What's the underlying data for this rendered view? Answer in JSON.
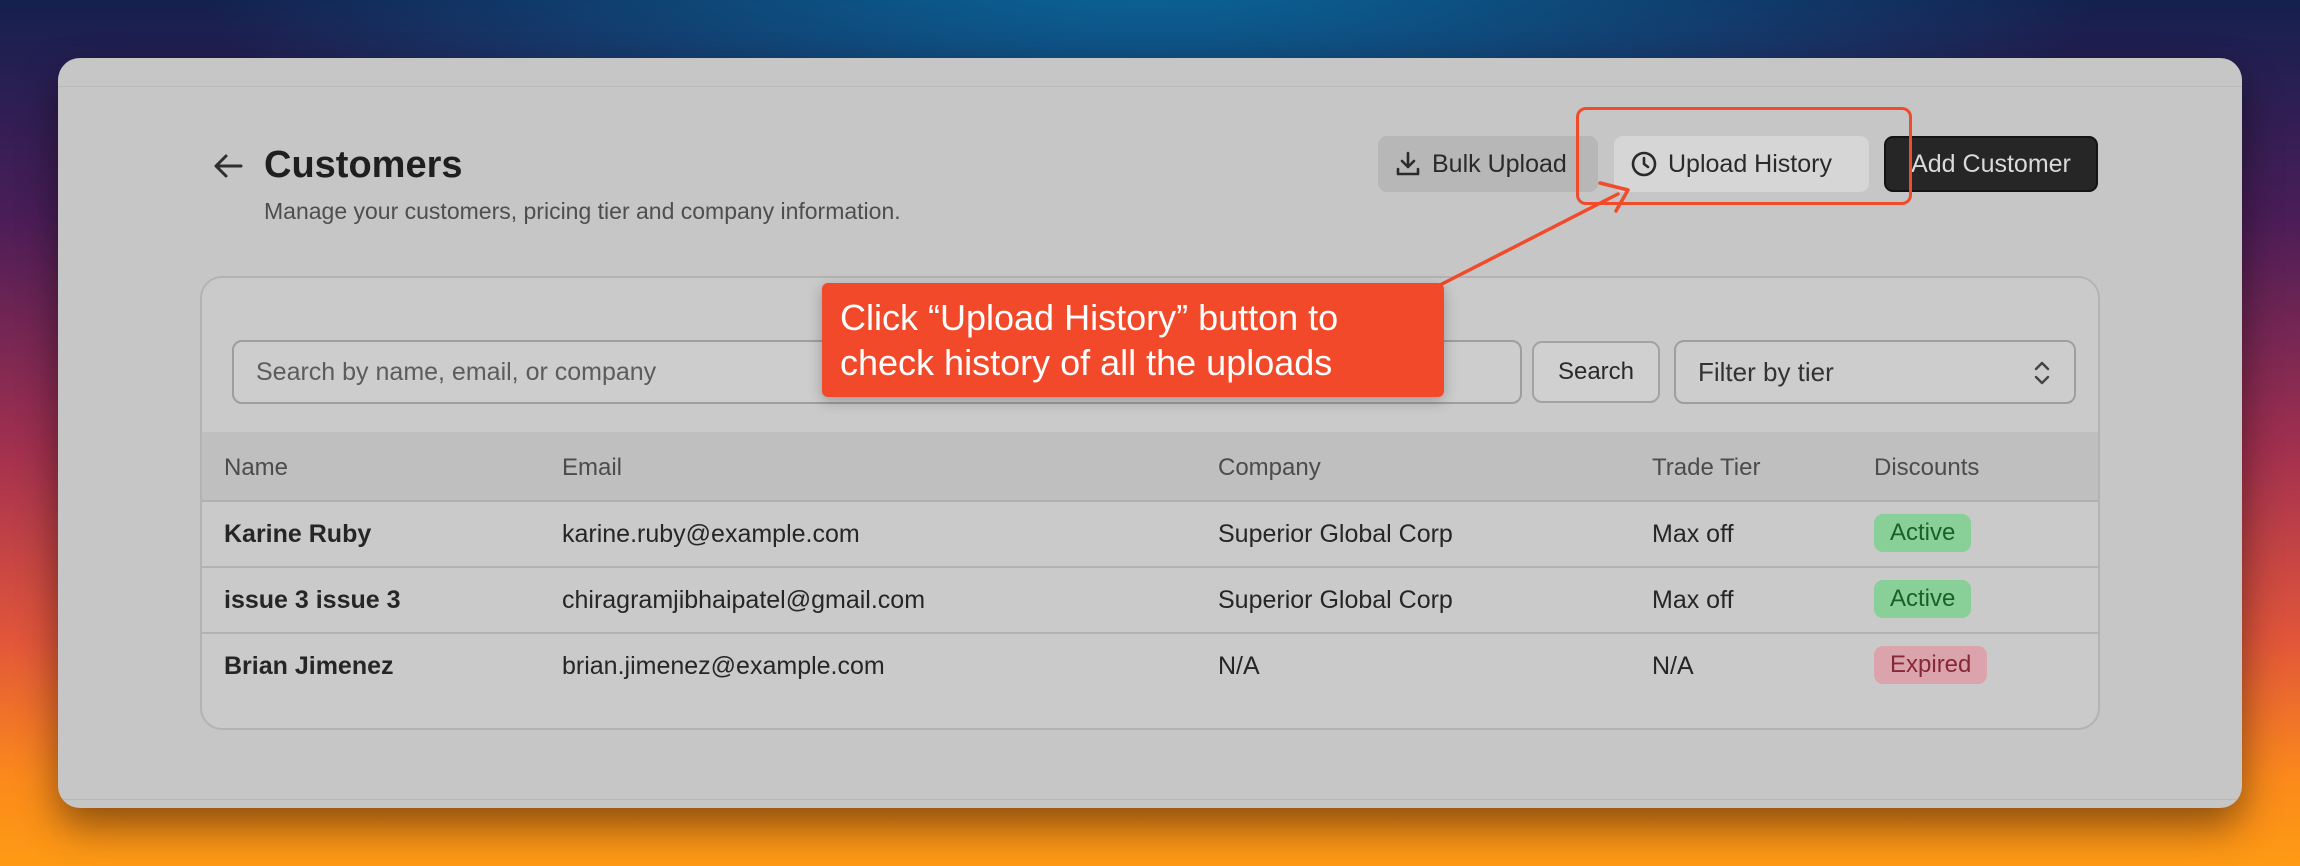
{
  "header": {
    "title": "Customers",
    "subtitle": "Manage your customers, pricing tier and company information.",
    "bulk_upload_label": "Bulk Upload",
    "upload_history_label": "Upload History",
    "add_customer_label": "Add Customer"
  },
  "filters": {
    "search_placeholder": "Search by name, email, or company",
    "search_button_label": "Search",
    "tier_select_value": "Filter by tier"
  },
  "table": {
    "columns": [
      "Name",
      "Email",
      "Company",
      "Trade Tier",
      "Discounts"
    ],
    "rows": [
      {
        "name": "Karine Ruby",
        "email": "karine.ruby@example.com",
        "company": "Superior Global Corp",
        "tier": "Max off",
        "discount": "Active"
      },
      {
        "name": "issue 3 issue 3",
        "email": "chiragramjibhaipatel@gmail.com",
        "company": "Superior Global Corp",
        "tier": "Max off",
        "discount": "Active"
      },
      {
        "name": "Brian Jimenez",
        "email": "brian.jimenez@example.com",
        "company": "N/A",
        "tier": "N/A",
        "discount": "Expired"
      }
    ]
  },
  "annotation": {
    "callout_line1": "Click “Upload History” button to",
    "callout_line2": "check history of all the uploads",
    "accent_color": "#f1492a"
  },
  "icons": {
    "back": "arrow-left-icon",
    "bulk_upload": "download-icon",
    "upload_history": "clock-icon",
    "tier_select": "chevron-up-down-icon"
  },
  "colors": {
    "active_badge": "#88cf98",
    "expired_badge": "#dba4ac",
    "primary_button": "#262626"
  }
}
